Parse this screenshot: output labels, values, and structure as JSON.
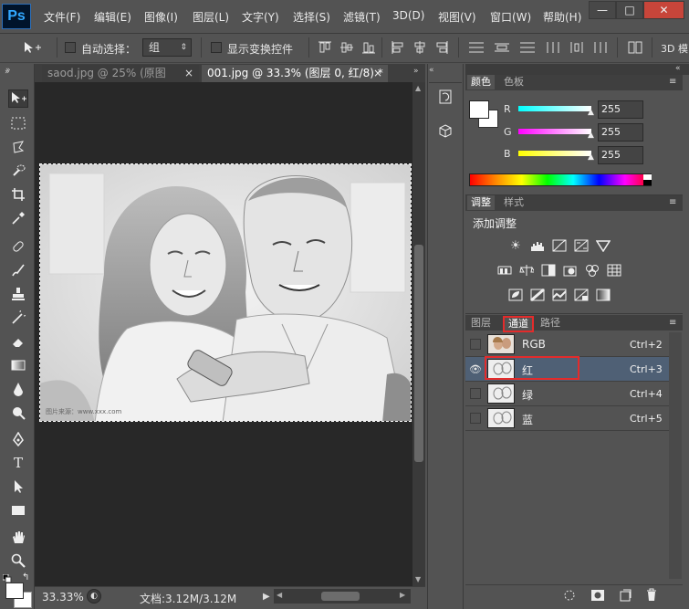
{
  "app": {
    "logo": "Ps"
  },
  "menu": [
    "文件(F)",
    "编辑(E)",
    "图像(I)",
    "图层(L)",
    "文字(Y)",
    "选择(S)",
    "滤镜(T)",
    "3D(D)",
    "视图(V)",
    "窗口(W)",
    "帮助(H)"
  ],
  "window_controls": [
    "—",
    "□",
    "✕"
  ],
  "options": {
    "auto_select_label": "自动选择：",
    "auto_select_value": "组",
    "show_transform_label": "显示变换控件",
    "mode_3d": "3D 模"
  },
  "tabs": [
    {
      "label": "saod.jpg @ 25% (原图",
      "close": "×"
    },
    {
      "label": "001.jpg @ 33.3% (图层 0, 红/8) *",
      "close": "×"
    }
  ],
  "watermark": "图片来源：www.xxx.com",
  "status": {
    "zoom": "33.33%",
    "doc": "文档:3.12M/3.12M"
  },
  "color_panel": {
    "tabs": [
      "颜色",
      "色板"
    ],
    "sliders": [
      {
        "label": "R",
        "value": "255",
        "color": "#00ffff"
      },
      {
        "label": "G",
        "value": "255",
        "color": "#ff00ff"
      },
      {
        "label": "B",
        "value": "255",
        "color": "#ffff00"
      }
    ]
  },
  "adjust_panel": {
    "tabs": [
      "调整",
      "样式"
    ],
    "title": "添加调整",
    "icons_row1": [
      "brightness-icon",
      "levels-icon",
      "curves-icon",
      "exposure-icon",
      "gradient-triangle-icon"
    ],
    "icons_row2": [
      "vibrance-icon",
      "balance-icon",
      "bw-icon",
      "photo-filter-icon",
      "channel-mixer-icon",
      "lookup-grid-icon"
    ],
    "icons_row3": [
      "invert-icon",
      "posterize-icon",
      "threshold-icon",
      "selective-color-icon",
      "gradient-map-icon"
    ]
  },
  "layers_panel": {
    "tabs": [
      "图层",
      "通道",
      "路径"
    ],
    "channels": [
      {
        "name": "RGB",
        "shortcut": "Ctrl+2",
        "visible": false,
        "selected": false
      },
      {
        "name": "红",
        "shortcut": "Ctrl+3",
        "visible": true,
        "selected": true
      },
      {
        "name": "绿",
        "shortcut": "Ctrl+4",
        "visible": false,
        "selected": false
      },
      {
        "name": "蓝",
        "shortcut": "Ctrl+5",
        "visible": false,
        "selected": false
      }
    ]
  },
  "colors": {
    "selection_highlight": "#4f6075",
    "annotation": "#e32b2b",
    "canvas_bg": "#282828",
    "ui_bg": "#535353"
  }
}
